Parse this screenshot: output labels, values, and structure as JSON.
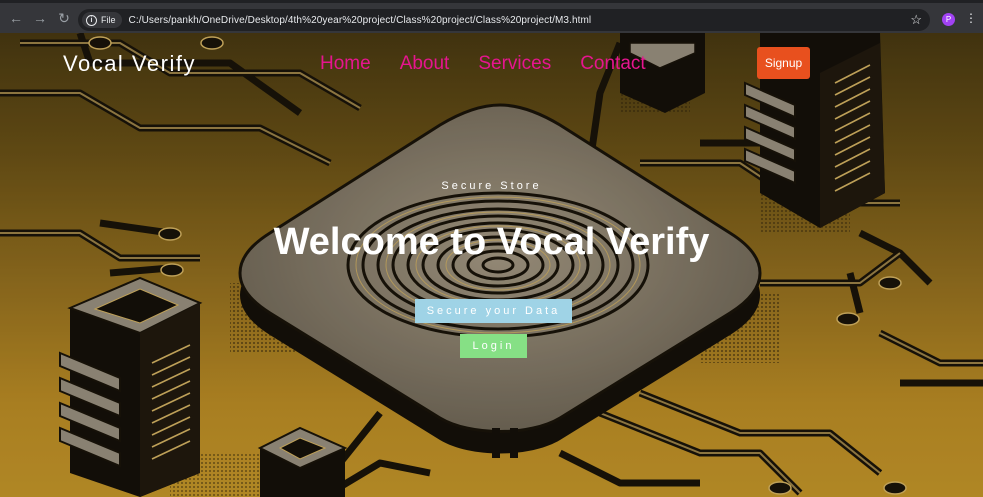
{
  "browser": {
    "file_label": "File",
    "url": "C:/Users/pankh/OneDrive/Desktop/4th%20year%20project/Class%20project/Class%20project/M3.html",
    "profile_initial": "P",
    "icons": [
      "back-arrow-icon",
      "forward-arrow-icon",
      "reload-icon",
      "info-icon",
      "star-icon",
      "kebab-menu-icon"
    ]
  },
  "site": {
    "brand": "Vocal Verify",
    "nav": [
      {
        "label": "Home"
      },
      {
        "label": "About"
      },
      {
        "label": "Services"
      },
      {
        "label": "Contact"
      }
    ],
    "signup_label": "Signup"
  },
  "hero": {
    "subtitle": "Secure Store",
    "title": "Welcome to Vocal Verify",
    "primary_button": "Secure your Data",
    "secondary_button": "Login"
  },
  "colors": {
    "nav_link": "#e6158f",
    "signup_bg": "#e8501e",
    "secure_btn_bg": "#9fd3e6",
    "login_btn_bg": "#86e085",
    "background_gold": "#c99a2a"
  }
}
